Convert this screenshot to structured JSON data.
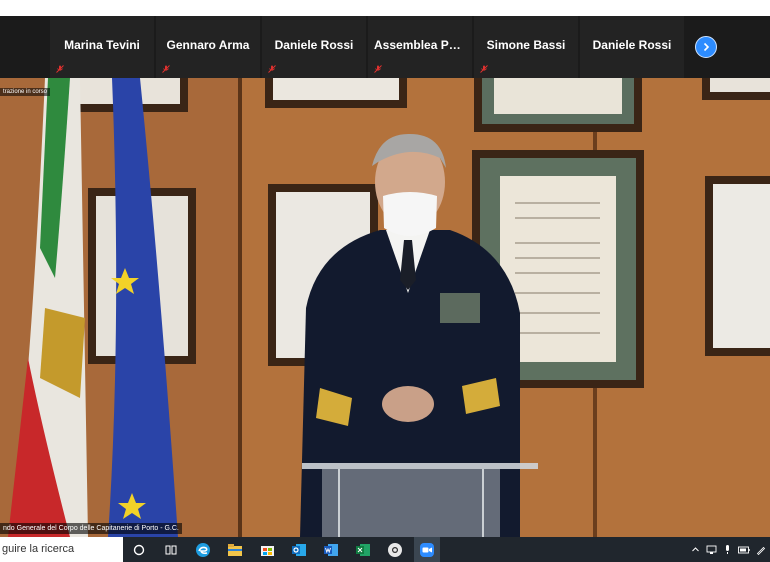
{
  "participants": [
    {
      "name": "Marina Tevini"
    },
    {
      "name": "Gennaro Arma"
    },
    {
      "name": "Daniele Rossi"
    },
    {
      "name": "Assemblea Pub..."
    },
    {
      "name": "Simone Bassi"
    },
    {
      "name": "Daniele Rossi"
    }
  ],
  "recording_label": "trazione in corso",
  "speaker_caption": "ndo Generale del Corpo delle Capitanerie di Porto - G.C.",
  "taskbar": {
    "search_placeholder": "guire la ricerca"
  },
  "colors": {
    "accent": "#2d8cff",
    "mute": "#e0312f",
    "taskbar": "#20262d",
    "tile": "#232323"
  },
  "icons": [
    "chevron-right-icon",
    "muted-mic-icon",
    "cortana-icon",
    "task-view-icon",
    "edge-icon",
    "file-explorer-icon",
    "store-icon",
    "outlook-icon",
    "word-icon",
    "excel-icon",
    "chrome-icon",
    "zoom-icon",
    "chevron-up-icon",
    "network-icon",
    "mic-icon",
    "battery-icon",
    "pen-icon"
  ]
}
